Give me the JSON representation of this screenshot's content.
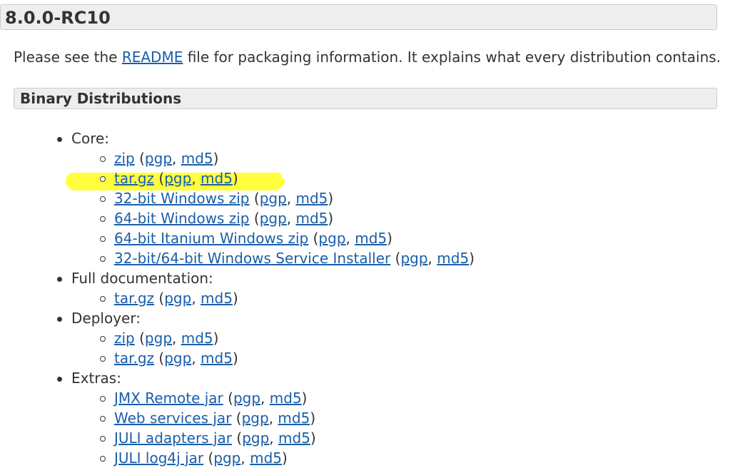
{
  "version": {
    "title": "8.0.0-RC10"
  },
  "intro": {
    "prefix": "Please see the ",
    "link": "README",
    "suffix": " file for packaging information. It explains what every distribution contains."
  },
  "section": {
    "title": "Binary Distributions"
  },
  "highlight_color": "#ffff33",
  "link_color": "#1a5eaa",
  "categories": [
    {
      "label": "Core:",
      "files": [
        {
          "name": "zip",
          "sigs": [
            "pgp",
            "md5"
          ]
        },
        {
          "name": "tar.gz",
          "sigs": [
            "pgp",
            "md5"
          ],
          "highlighted": true
        },
        {
          "name": "32-bit Windows zip",
          "sigs": [
            "pgp",
            "md5"
          ]
        },
        {
          "name": "64-bit Windows zip",
          "sigs": [
            "pgp",
            "md5"
          ]
        },
        {
          "name": "64-bit Itanium Windows zip",
          "sigs": [
            "pgp",
            "md5"
          ]
        },
        {
          "name": "32-bit/64-bit Windows Service Installer",
          "sigs": [
            "pgp",
            "md5"
          ]
        }
      ]
    },
    {
      "label": "Full documentation:",
      "files": [
        {
          "name": "tar.gz",
          "sigs": [
            "pgp",
            "md5"
          ]
        }
      ]
    },
    {
      "label": "Deployer:",
      "files": [
        {
          "name": "zip",
          "sigs": [
            "pgp",
            "md5"
          ]
        },
        {
          "name": "tar.gz",
          "sigs": [
            "pgp",
            "md5"
          ]
        }
      ]
    },
    {
      "label": "Extras:",
      "files": [
        {
          "name": "JMX Remote jar",
          "sigs": [
            "pgp",
            "md5"
          ]
        },
        {
          "name": "Web services jar",
          "sigs": [
            "pgp",
            "md5"
          ]
        },
        {
          "name": "JULI adapters jar",
          "sigs": [
            "pgp",
            "md5"
          ]
        },
        {
          "name": "JULI log4j jar",
          "sigs": [
            "pgp",
            "md5"
          ]
        }
      ]
    }
  ]
}
